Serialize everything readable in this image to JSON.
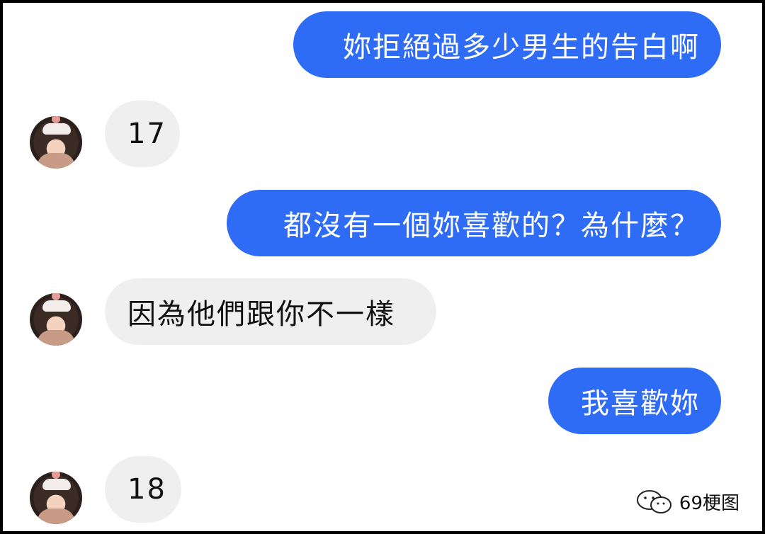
{
  "messages": [
    {
      "side": "out",
      "text": "妳拒絕過多少男生的告白啊"
    },
    {
      "side": "in",
      "text": "17"
    },
    {
      "side": "out",
      "text": "都沒有一個妳喜歡的？為什麼？"
    },
    {
      "side": "in",
      "text": "因為他們跟你不一樣"
    },
    {
      "side": "out",
      "text": "我喜歡妳"
    },
    {
      "side": "in",
      "text": "18"
    }
  ],
  "watermark": {
    "text": "69梗图",
    "icon": "wechat-icon"
  },
  "colors": {
    "outgoing_bubble": "#2f6cf6",
    "incoming_bubble": "#efefef"
  }
}
